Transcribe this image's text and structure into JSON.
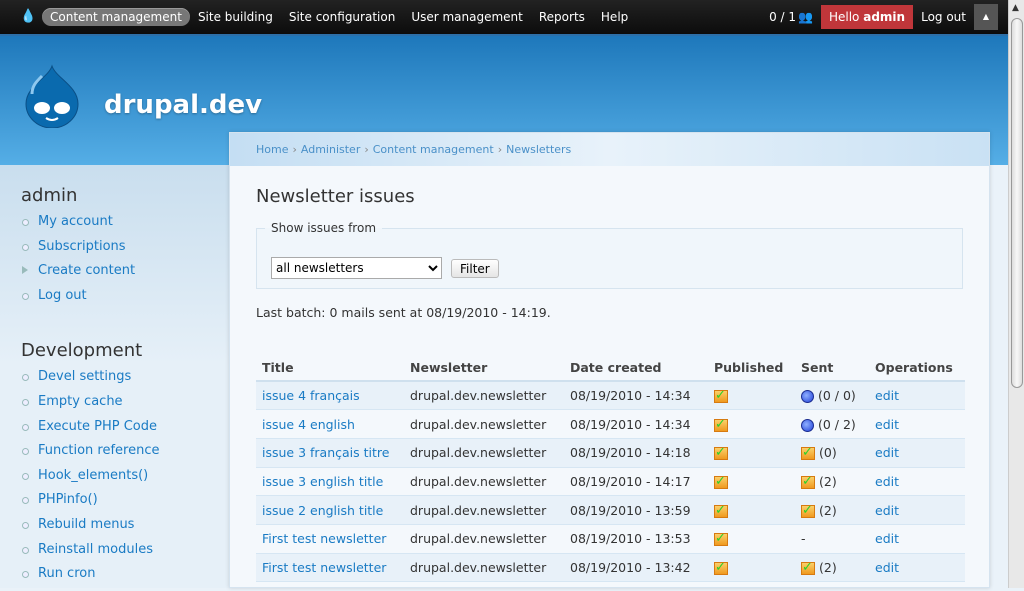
{
  "topbar": {
    "nav": [
      "Content management",
      "Site building",
      "Site configuration",
      "User management",
      "Reports",
      "Help"
    ],
    "users_count": "0 / 1",
    "hello": "Hello",
    "user": "admin",
    "logout": "Log out"
  },
  "site": {
    "name": "drupal.dev"
  },
  "sidebar": {
    "user_title": "admin",
    "user_links": [
      "My account",
      "Subscriptions",
      "Create content",
      "Log out"
    ],
    "dev_title": "Development",
    "dev_links": [
      "Devel settings",
      "Empty cache",
      "Execute PHP Code",
      "Function reference",
      "Hook_elements()",
      "PHPinfo()",
      "Rebuild menus",
      "Reinstall modules",
      "Run cron"
    ]
  },
  "breadcrumb": [
    "Home",
    "Administer",
    "Content management",
    "Newsletters"
  ],
  "main": {
    "title": "Newsletter issues",
    "fieldset_legend": "Show issues from",
    "select_value": "all newsletters",
    "filter_label": "Filter",
    "last_batch": "Last batch: 0 mails sent at 08/19/2010 - 14:19."
  },
  "table": {
    "headers": [
      "Title",
      "Newsletter",
      "Date created",
      "Published",
      "Sent",
      "Operations"
    ],
    "rows": [
      {
        "title": "issue 4 français",
        "newsletter": "drupal.dev.newsletter",
        "date": "08/19/2010 - 14:34",
        "sent_icon": "clock",
        "sent": "(0 / 0)",
        "op": "edit"
      },
      {
        "title": "issue 4 english",
        "newsletter": "drupal.dev.newsletter",
        "date": "08/19/2010 - 14:34",
        "sent_icon": "clock",
        "sent": "(0 / 2)",
        "op": "edit"
      },
      {
        "title": "issue 3 français titre",
        "newsletter": "drupal.dev.newsletter",
        "date": "08/19/2010 - 14:18",
        "sent_icon": "check",
        "sent": "(0)",
        "op": "edit"
      },
      {
        "title": "issue 3 english title",
        "newsletter": "drupal.dev.newsletter",
        "date": "08/19/2010 - 14:17",
        "sent_icon": "check",
        "sent": "(2)",
        "op": "edit"
      },
      {
        "title": "issue 2 english title",
        "newsletter": "drupal.dev.newsletter",
        "date": "08/19/2010 - 13:59",
        "sent_icon": "check",
        "sent": "(2)",
        "op": "edit"
      },
      {
        "title": "First test newsletter",
        "newsletter": "drupal.dev.newsletter",
        "date": "08/19/2010 - 13:53",
        "sent_icon": "none",
        "sent": "-",
        "op": "edit"
      },
      {
        "title": "First test newsletter",
        "newsletter": "drupal.dev.newsletter",
        "date": "08/19/2010 - 13:42",
        "sent_icon": "check",
        "sent": "(2)",
        "op": "edit"
      }
    ]
  }
}
